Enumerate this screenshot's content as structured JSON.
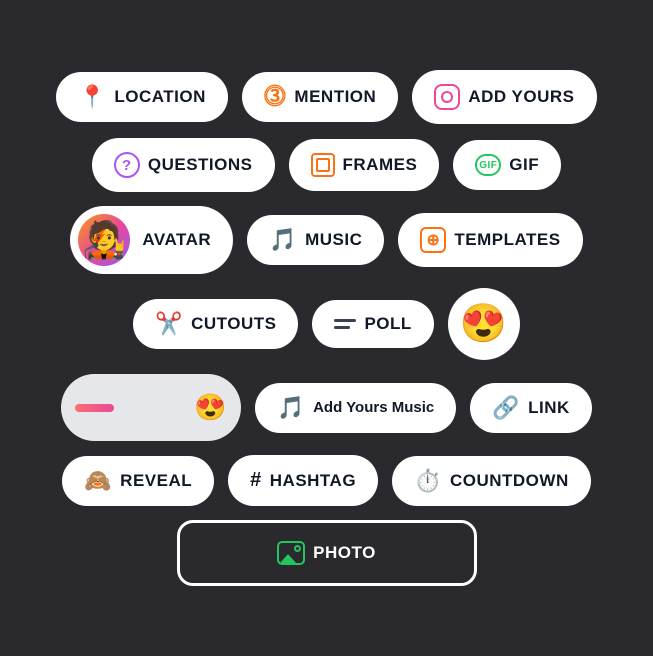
{
  "background": "#2a2a2e",
  "rows": [
    {
      "id": "row1",
      "buttons": [
        {
          "id": "location",
          "label": "LOCATION",
          "iconType": "location"
        },
        {
          "id": "mention",
          "label": "MENTION",
          "iconType": "mention"
        },
        {
          "id": "addyours",
          "label": "ADD YOURS",
          "iconType": "camera"
        }
      ]
    },
    {
      "id": "row2",
      "buttons": [
        {
          "id": "questions",
          "label": "QUESTIONS",
          "iconType": "question"
        },
        {
          "id": "frames",
          "label": "FRAMES",
          "iconType": "frames"
        },
        {
          "id": "gif",
          "label": "GIF",
          "iconType": "gif"
        }
      ]
    },
    {
      "id": "row3",
      "buttons": [
        {
          "id": "avatar",
          "label": "AVATAR",
          "iconType": "avatar"
        },
        {
          "id": "music",
          "label": "MUSIC",
          "iconType": "music"
        },
        {
          "id": "templates",
          "label": "TEMPLATES",
          "iconType": "templates"
        }
      ]
    },
    {
      "id": "row4",
      "buttons": [
        {
          "id": "cutouts",
          "label": "CUTOUTS",
          "iconType": "scissors"
        },
        {
          "id": "poll",
          "label": "POLL",
          "iconType": "poll"
        },
        {
          "id": "emoji",
          "label": "😍",
          "iconType": "emoji"
        }
      ]
    },
    {
      "id": "row5",
      "buttons": [
        {
          "id": "slider",
          "label": "",
          "iconType": "slider"
        },
        {
          "id": "addyoursmusic",
          "label": "Add Yours Music",
          "iconType": "addmusic"
        },
        {
          "id": "link",
          "label": "LINK",
          "iconType": "link"
        }
      ]
    },
    {
      "id": "row6",
      "buttons": [
        {
          "id": "reveal",
          "label": "REVEAL",
          "iconType": "reveal"
        },
        {
          "id": "hashtag",
          "label": "HASHTAG",
          "iconType": "hash"
        },
        {
          "id": "countdown",
          "label": "COUNTDOWN",
          "iconType": "countdown"
        }
      ]
    },
    {
      "id": "row7",
      "buttons": [
        {
          "id": "photo",
          "label": "PHOTO",
          "iconType": "photo"
        }
      ]
    }
  ]
}
